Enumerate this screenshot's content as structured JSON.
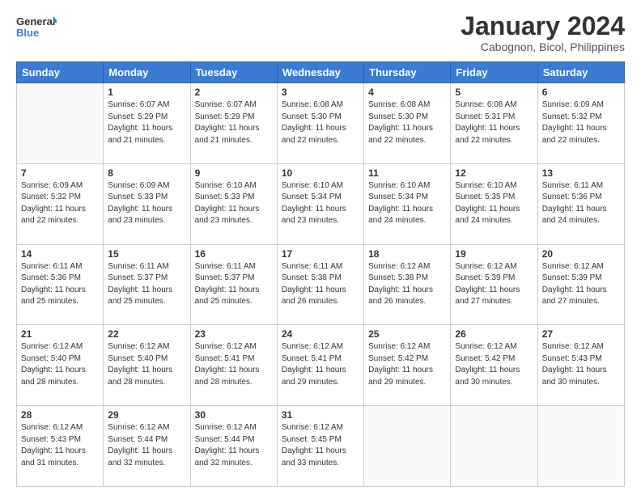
{
  "logo": {
    "line1": "General",
    "line2": "Blue"
  },
  "title": "January 2024",
  "subtitle": "Cabognon, Bicol, Philippines",
  "days_of_week": [
    "Sunday",
    "Monday",
    "Tuesday",
    "Wednesday",
    "Thursday",
    "Friday",
    "Saturday"
  ],
  "weeks": [
    [
      {
        "day": "",
        "sunrise": "",
        "sunset": "",
        "daylight": ""
      },
      {
        "day": "1",
        "sunrise": "6:07 AM",
        "sunset": "5:29 PM",
        "daylight": "11 hours and 21 minutes."
      },
      {
        "day": "2",
        "sunrise": "6:07 AM",
        "sunset": "5:29 PM",
        "daylight": "11 hours and 21 minutes."
      },
      {
        "day": "3",
        "sunrise": "6:08 AM",
        "sunset": "5:30 PM",
        "daylight": "11 hours and 22 minutes."
      },
      {
        "day": "4",
        "sunrise": "6:08 AM",
        "sunset": "5:30 PM",
        "daylight": "11 hours and 22 minutes."
      },
      {
        "day": "5",
        "sunrise": "6:08 AM",
        "sunset": "5:31 PM",
        "daylight": "11 hours and 22 minutes."
      },
      {
        "day": "6",
        "sunrise": "6:09 AM",
        "sunset": "5:32 PM",
        "daylight": "11 hours and 22 minutes."
      }
    ],
    [
      {
        "day": "7",
        "sunrise": "6:09 AM",
        "sunset": "5:32 PM",
        "daylight": "11 hours and 22 minutes."
      },
      {
        "day": "8",
        "sunrise": "6:09 AM",
        "sunset": "5:33 PM",
        "daylight": "11 hours and 23 minutes."
      },
      {
        "day": "9",
        "sunrise": "6:10 AM",
        "sunset": "5:33 PM",
        "daylight": "11 hours and 23 minutes."
      },
      {
        "day": "10",
        "sunrise": "6:10 AM",
        "sunset": "5:34 PM",
        "daylight": "11 hours and 23 minutes."
      },
      {
        "day": "11",
        "sunrise": "6:10 AM",
        "sunset": "5:34 PM",
        "daylight": "11 hours and 24 minutes."
      },
      {
        "day": "12",
        "sunrise": "6:10 AM",
        "sunset": "5:35 PM",
        "daylight": "11 hours and 24 minutes."
      },
      {
        "day": "13",
        "sunrise": "6:11 AM",
        "sunset": "5:36 PM",
        "daylight": "11 hours and 24 minutes."
      }
    ],
    [
      {
        "day": "14",
        "sunrise": "6:11 AM",
        "sunset": "5:36 PM",
        "daylight": "11 hours and 25 minutes."
      },
      {
        "day": "15",
        "sunrise": "6:11 AM",
        "sunset": "5:37 PM",
        "daylight": "11 hours and 25 minutes."
      },
      {
        "day": "16",
        "sunrise": "6:11 AM",
        "sunset": "5:37 PM",
        "daylight": "11 hours and 25 minutes."
      },
      {
        "day": "17",
        "sunrise": "6:11 AM",
        "sunset": "5:38 PM",
        "daylight": "11 hours and 26 minutes."
      },
      {
        "day": "18",
        "sunrise": "6:12 AM",
        "sunset": "5:38 PM",
        "daylight": "11 hours and 26 minutes."
      },
      {
        "day": "19",
        "sunrise": "6:12 AM",
        "sunset": "5:39 PM",
        "daylight": "11 hours and 27 minutes."
      },
      {
        "day": "20",
        "sunrise": "6:12 AM",
        "sunset": "5:39 PM",
        "daylight": "11 hours and 27 minutes."
      }
    ],
    [
      {
        "day": "21",
        "sunrise": "6:12 AM",
        "sunset": "5:40 PM",
        "daylight": "11 hours and 28 minutes."
      },
      {
        "day": "22",
        "sunrise": "6:12 AM",
        "sunset": "5:40 PM",
        "daylight": "11 hours and 28 minutes."
      },
      {
        "day": "23",
        "sunrise": "6:12 AM",
        "sunset": "5:41 PM",
        "daylight": "11 hours and 28 minutes."
      },
      {
        "day": "24",
        "sunrise": "6:12 AM",
        "sunset": "5:41 PM",
        "daylight": "11 hours and 29 minutes."
      },
      {
        "day": "25",
        "sunrise": "6:12 AM",
        "sunset": "5:42 PM",
        "daylight": "11 hours and 29 minutes."
      },
      {
        "day": "26",
        "sunrise": "6:12 AM",
        "sunset": "5:42 PM",
        "daylight": "11 hours and 30 minutes."
      },
      {
        "day": "27",
        "sunrise": "6:12 AM",
        "sunset": "5:43 PM",
        "daylight": "11 hours and 30 minutes."
      }
    ],
    [
      {
        "day": "28",
        "sunrise": "6:12 AM",
        "sunset": "5:43 PM",
        "daylight": "11 hours and 31 minutes."
      },
      {
        "day": "29",
        "sunrise": "6:12 AM",
        "sunset": "5:44 PM",
        "daylight": "11 hours and 32 minutes."
      },
      {
        "day": "30",
        "sunrise": "6:12 AM",
        "sunset": "5:44 PM",
        "daylight": "11 hours and 32 minutes."
      },
      {
        "day": "31",
        "sunrise": "6:12 AM",
        "sunset": "5:45 PM",
        "daylight": "11 hours and 33 minutes."
      },
      {
        "day": "",
        "sunrise": "",
        "sunset": "",
        "daylight": ""
      },
      {
        "day": "",
        "sunrise": "",
        "sunset": "",
        "daylight": ""
      },
      {
        "day": "",
        "sunrise": "",
        "sunset": "",
        "daylight": ""
      }
    ]
  ]
}
